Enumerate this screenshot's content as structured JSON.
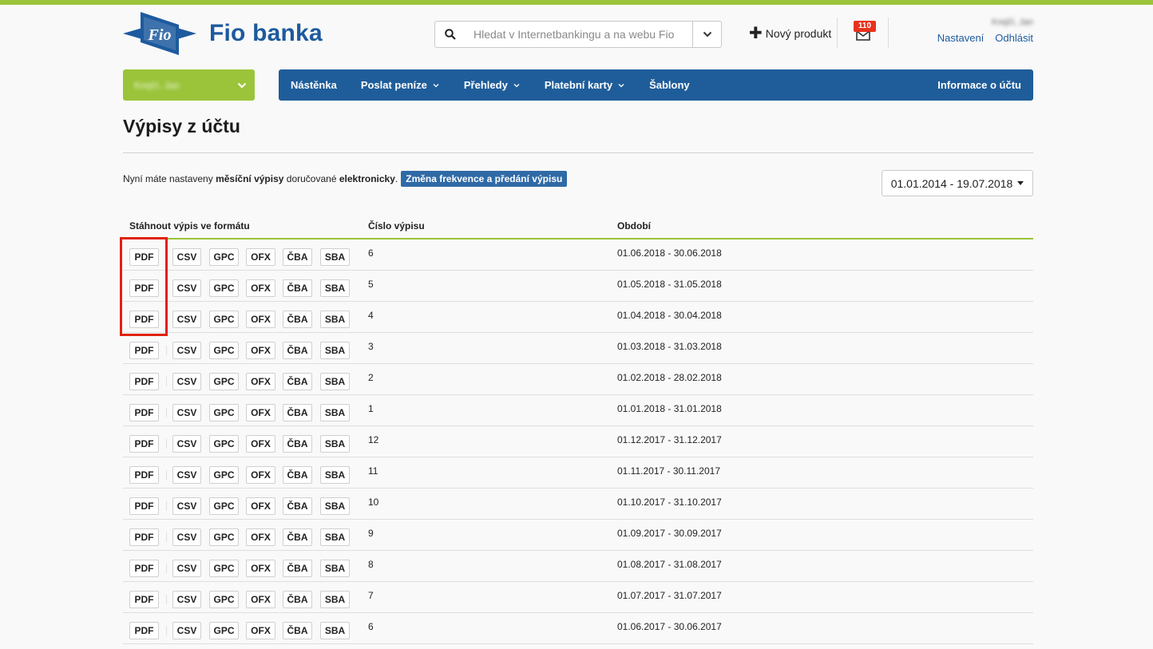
{
  "header": {
    "logo_mark": "Fio",
    "logo_text": "Fio banka",
    "search_placeholder": "Hledat v Internetbankingu a na webu Fio",
    "new_product": "Nový produkt",
    "mail_count": "110",
    "user_name": "Krejčí, Jan",
    "settings": "Nastavení",
    "logout": "Odhlásit"
  },
  "nav": {
    "account": "Krejčí, Jan",
    "items": [
      {
        "label": "Nástěnka",
        "dropdown": false
      },
      {
        "label": "Poslat peníze",
        "dropdown": true
      },
      {
        "label": "Přehledy",
        "dropdown": true
      },
      {
        "label": "Platební karty",
        "dropdown": true
      },
      {
        "label": "Šablony",
        "dropdown": false
      }
    ],
    "account_info": "Informace o účtu"
  },
  "page": {
    "title": "Výpisy z účtu",
    "info_prefix": "Nyní máte nastaveny ",
    "info_bold1": "měsíční výpisy",
    "info_mid": " doručované ",
    "info_bold2": "elektronicky",
    "info_suffix": ".",
    "change_button": "Změna frekvence a předání výpisu",
    "date_range": "01.01.2014 - 19.07.2018"
  },
  "table": {
    "headers": [
      "Stáhnout výpis ve formátu",
      "Číslo výpisu",
      "Období"
    ],
    "formats": [
      "PDF",
      "CSV",
      "GPC",
      "OFX",
      "ČBA",
      "SBA"
    ],
    "rows": [
      {
        "num": "6",
        "period": "01.06.2018 - 30.06.2018"
      },
      {
        "num": "5",
        "period": "01.05.2018 - 31.05.2018"
      },
      {
        "num": "4",
        "period": "01.04.2018 - 30.04.2018"
      },
      {
        "num": "3",
        "period": "01.03.2018 - 31.03.2018"
      },
      {
        "num": "2",
        "period": "01.02.2018 - 28.02.2018"
      },
      {
        "num": "1",
        "period": "01.01.2018 - 31.01.2018"
      },
      {
        "num": "12",
        "period": "01.12.2017 - 31.12.2017"
      },
      {
        "num": "11",
        "period": "01.11.2017 - 30.11.2017"
      },
      {
        "num": "10",
        "period": "01.10.2017 - 31.10.2017"
      },
      {
        "num": "9",
        "period": "01.09.2017 - 30.09.2017"
      },
      {
        "num": "8",
        "period": "01.08.2017 - 31.08.2017"
      },
      {
        "num": "7",
        "period": "01.07.2017 - 31.07.2017"
      },
      {
        "num": "6",
        "period": "01.06.2017 - 30.06.2017"
      }
    ]
  },
  "colors": {
    "green": "#9bc43a",
    "blue": "#1f5d9a",
    "highlight": "#e0210b"
  }
}
